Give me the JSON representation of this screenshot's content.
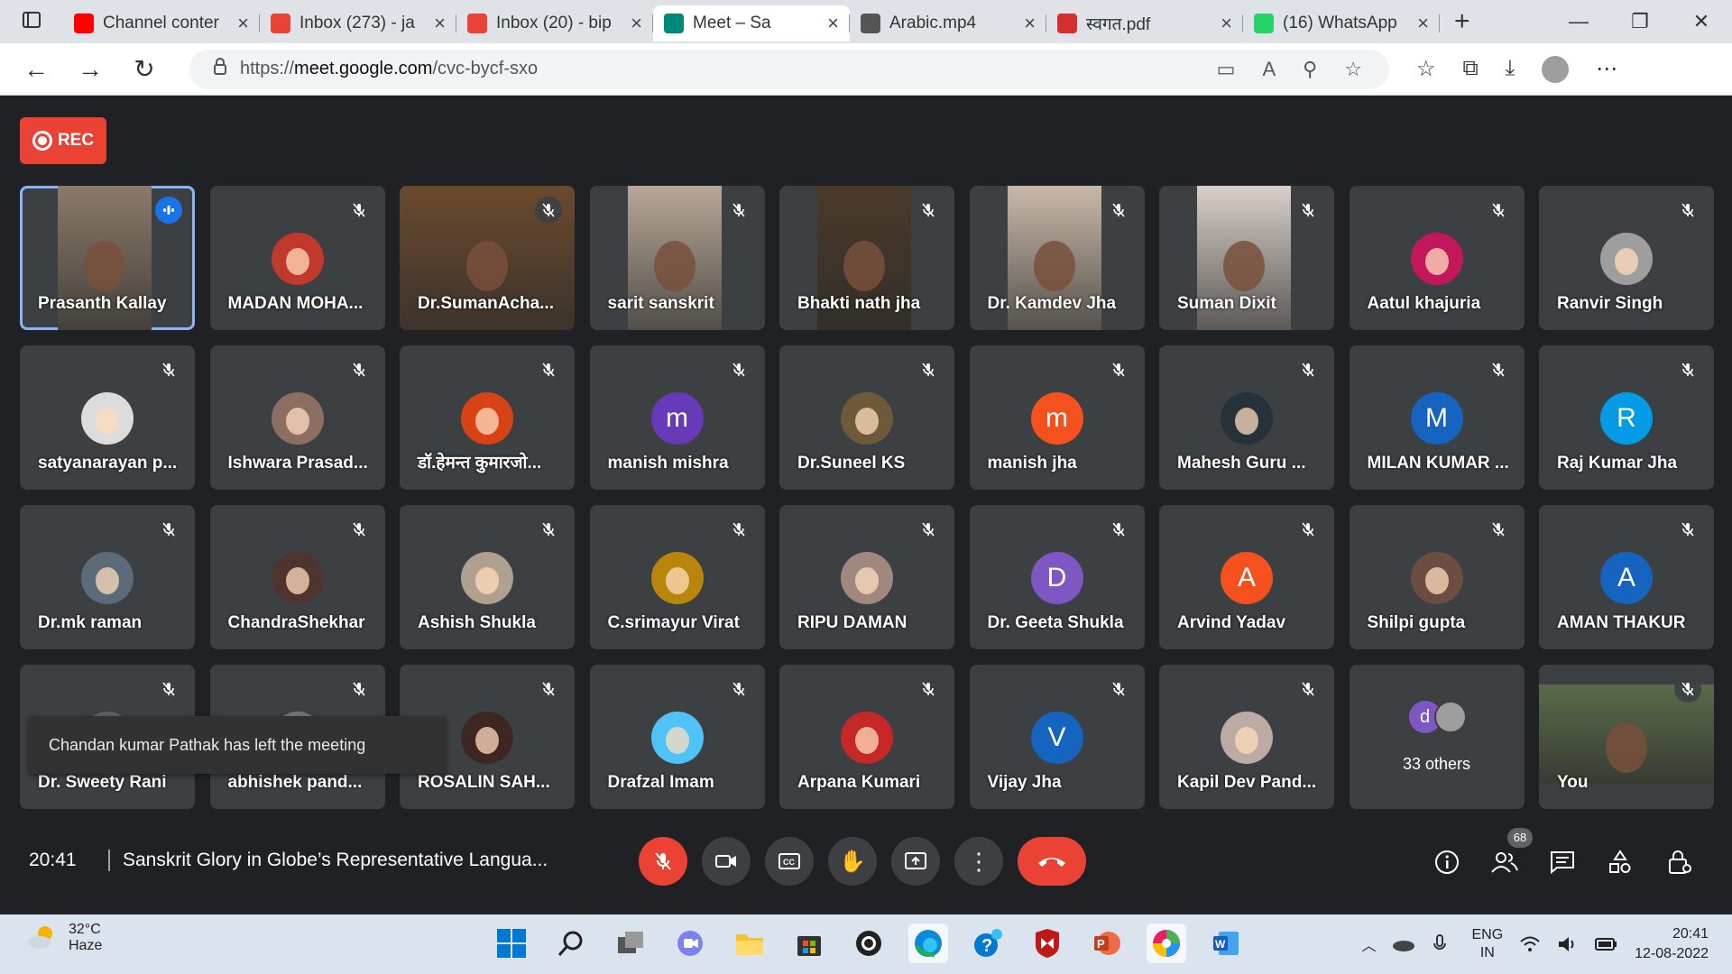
{
  "browser": {
    "tabs": [
      {
        "title": "Channel conter",
        "icon_color": "#ff0000",
        "icon": "youtube-icon"
      },
      {
        "title": "Inbox (273) - ja",
        "icon_color": "#ea4335",
        "icon": "gmail-icon"
      },
      {
        "title": "Inbox (20) - bip",
        "icon_color": "#ea4335",
        "icon": "gmail-icon"
      },
      {
        "title": "Meet – Sa",
        "icon_color": "#00897b",
        "icon": "meet-icon"
      },
      {
        "title": "Arabic.mp4",
        "icon_color": "#555555",
        "icon": "file-icon"
      },
      {
        "title": "स्वगत.pdf",
        "icon_color": "#d32f2f",
        "icon": "pdf-icon"
      },
      {
        "title": "(16) WhatsApp",
        "icon_color": "#25d366",
        "icon": "whatsapp-icon"
      }
    ],
    "url_prefix": "https://",
    "url_host": "meet.google.com",
    "url_path": "/cvc-bycf-sxo"
  },
  "meet": {
    "rec_label": "REC",
    "toast": "Chandan kumar Pathak has left the meeting",
    "time": "20:41",
    "meeting_title": "Sanskrit Glory in Globe’s Representative Langua...",
    "participant_count": "68",
    "others_label": "33 others",
    "tiles": [
      {
        "name": "Prasanth Kallay",
        "type": "video",
        "color": "#8a7a6a",
        "speaking": true
      },
      {
        "name": "MADAN MOHA...",
        "type": "photo",
        "color": "#c0392b"
      },
      {
        "name": "Dr.SumanAcha...",
        "type": "video",
        "color": "#6b4a2e"
      },
      {
        "name": "sarit sanskrit",
        "type": "video",
        "color": "#b8a898"
      },
      {
        "name": "Bhakti nath jha",
        "type": "video",
        "color": "#4a3a2a"
      },
      {
        "name": "Dr. Kamdev Jha",
        "type": "video",
        "color": "#c8b8a8"
      },
      {
        "name": "Suman Dixit",
        "type": "video",
        "color": "#d8d0c8"
      },
      {
        "name": "Aatul khajuria",
        "type": "photo",
        "color": "#c2185b"
      },
      {
        "name": "Ranvir Singh",
        "type": "photo",
        "color": "#9e9e9e"
      },
      {
        "name": "satyanarayan p...",
        "type": "photo",
        "color": "#dcdcdc"
      },
      {
        "name": "Ishwara Prasad...",
        "type": "photo",
        "color": "#8d6e63"
      },
      {
        "name": "डॉ.हेमन्त कुमारजो...",
        "type": "photo",
        "color": "#d84315"
      },
      {
        "name": "manish mishra",
        "type": "letter",
        "letter": "m",
        "color": "#673ab7"
      },
      {
        "name": "Dr.Suneel KS",
        "type": "photo",
        "color": "#6d5a3a"
      },
      {
        "name": "manish jha",
        "type": "letter",
        "letter": "m",
        "color": "#f4511e"
      },
      {
        "name": "Mahesh Guru ...",
        "type": "photo",
        "color": "#263238"
      },
      {
        "name": "MILAN KUMAR ...",
        "type": "letter",
        "letter": "M",
        "color": "#1565c0"
      },
      {
        "name": "Raj Kumar Jha",
        "type": "letter",
        "letter": "R",
        "color": "#039be5"
      },
      {
        "name": "Dr.mk raman",
        "type": "photo",
        "color": "#5c6b7a"
      },
      {
        "name": "ChandraShekhar",
        "type": "photo",
        "color": "#4e342e"
      },
      {
        "name": "Ashish Shukla",
        "type": "photo",
        "color": "#b0a090"
      },
      {
        "name": "C.srimayur Virat",
        "type": "photo",
        "color": "#b8860b"
      },
      {
        "name": "RIPU DAMAN",
        "type": "photo",
        "color": "#a1887f"
      },
      {
        "name": "Dr. Geeta Shukla",
        "type": "letter",
        "letter": "D",
        "color": "#7e57c2"
      },
      {
        "name": "Arvind Yadav",
        "type": "letter",
        "letter": "A",
        "color": "#f4511e"
      },
      {
        "name": "Shilpi gupta",
        "type": "photo",
        "color": "#6d4c41"
      },
      {
        "name": "AMAN THAKUR",
        "type": "letter",
        "letter": "A",
        "color": "#1565c0"
      },
      {
        "name": "Dr. Sweety Rani",
        "type": "photo",
        "color": "#616161"
      },
      {
        "name": "abhishek pand...",
        "type": "photo",
        "color": "#757575"
      },
      {
        "name": "ROSALIN SAH...",
        "type": "photo",
        "color": "#3e2723"
      },
      {
        "name": "Drafzal Imam",
        "type": "photo",
        "color": "#4fc3f7"
      },
      {
        "name": "Arpana Kumari",
        "type": "photo",
        "color": "#c62828"
      },
      {
        "name": "Vijay Jha",
        "type": "letter",
        "letter": "V",
        "color": "#1565c0"
      },
      {
        "name": "Kapil Dev Pand...",
        "type": "photo",
        "color": "#bcaaa4"
      },
      {
        "name": "",
        "type": "others",
        "color": "#3c4043"
      },
      {
        "name": "You",
        "type": "video",
        "color": "#5a6a4a"
      }
    ]
  },
  "taskbar": {
    "temp": "32°C",
    "weather": "Haze",
    "lang1": "ENG",
    "lang2": "IN",
    "time": "20:41",
    "date": "12-08-2022"
  }
}
